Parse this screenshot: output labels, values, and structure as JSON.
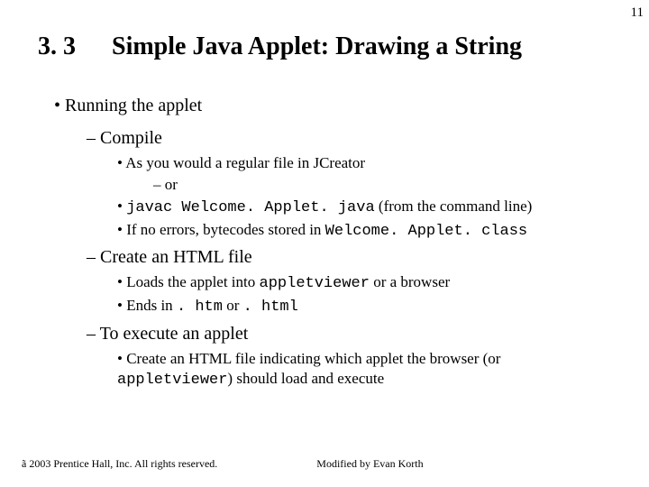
{
  "page_number": "11",
  "section_number": "3. 3",
  "section_title": "Simple Java Applet: Drawing a String",
  "bullets": {
    "running": "Running the applet",
    "compile": "Compile",
    "as_you_would": "As you would a regular file in JCreator",
    "or": "or",
    "javac_cmd": "javac Welcome. Applet. java",
    "from_cmd": "  (from the command line)",
    "if_no_errors_a": "If no errors, bytecodes stored in ",
    "if_no_errors_b": "Welcome. Applet. class",
    "create_html": "Create an HTML file",
    "loads_a": "Loads the applet into ",
    "loads_b": "appletviewer",
    "loads_c": " or a browser",
    "ends_a": "Ends in ",
    "ends_b": ". htm",
    "ends_c": " or ",
    "ends_d": ". html",
    "to_execute": "To execute an applet",
    "create_file_a": "Create an HTML file indicating which applet the browser (or ",
    "create_file_b": "appletviewer",
    "create_file_c": ") should load and execute"
  },
  "footer": {
    "copyright": "2003 Prentice Hall, Inc. All rights reserved.",
    "modified": "Modified by Evan Korth"
  }
}
